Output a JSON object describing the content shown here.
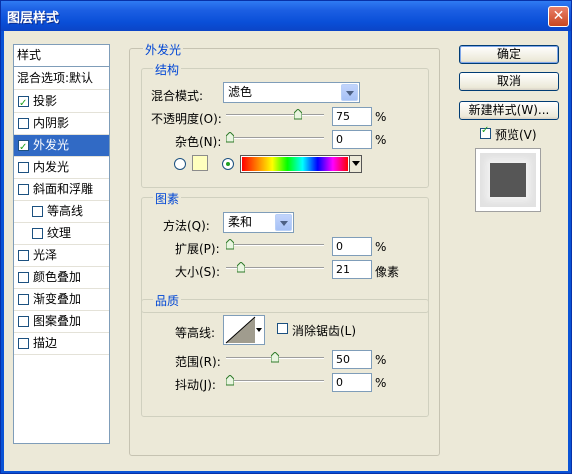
{
  "window": {
    "title": "图层样式"
  },
  "style_list": {
    "header": "样式",
    "blend_item": "混合选项:默认",
    "items": [
      {
        "label": "投影",
        "checked": true
      },
      {
        "label": "内阴影",
        "checked": false
      },
      {
        "label": "外发光",
        "checked": true,
        "selected": true
      },
      {
        "label": "内发光",
        "checked": false
      },
      {
        "label": "斜面和浮雕",
        "checked": false
      },
      {
        "label": "等高线",
        "checked": false,
        "indent": true
      },
      {
        "label": "纹理",
        "checked": false,
        "indent": true
      },
      {
        "label": "光泽",
        "checked": false
      },
      {
        "label": "颜色叠加",
        "checked": false
      },
      {
        "label": "渐变叠加",
        "checked": false
      },
      {
        "label": "图案叠加",
        "checked": false
      },
      {
        "label": "描边",
        "checked": false
      }
    ]
  },
  "panel": {
    "title": "外发光",
    "structure": {
      "title": "结构",
      "blend_mode_label": "混合模式:",
      "blend_mode_value": "滤色",
      "opacity_label": "不透明度(O):",
      "opacity_value": "75",
      "opacity_percent": 75,
      "noise_label": "杂色(N):",
      "noise_value": "0",
      "noise_percent": 0,
      "unit": "%",
      "solid_color": "#ffffbe"
    },
    "elements": {
      "title": "图素",
      "technique_label": "方法(Q):",
      "technique_value": "柔和",
      "spread_label": "扩展(P):",
      "spread_value": "0",
      "spread_percent": 0,
      "size_label": "大小(S):",
      "size_value": "21",
      "size_unit": "像素",
      "unit": "%"
    },
    "quality": {
      "title": "品质",
      "contour_label": "等高线:",
      "antialias_label": "消除锯齿(L)",
      "range_label": "范围(R):",
      "range_value": "50",
      "range_percent": 50,
      "jitter_label": "抖动(J):",
      "jitter_value": "0",
      "jitter_percent": 0,
      "unit": "%"
    }
  },
  "buttons": {
    "ok": "确定",
    "cancel": "取消",
    "new_style": "新建样式(W)...",
    "preview": "预览(V)"
  },
  "colors": {
    "accent": "#316ac5",
    "group_title": "#0046d5",
    "title_bar": "#0a53d6"
  }
}
